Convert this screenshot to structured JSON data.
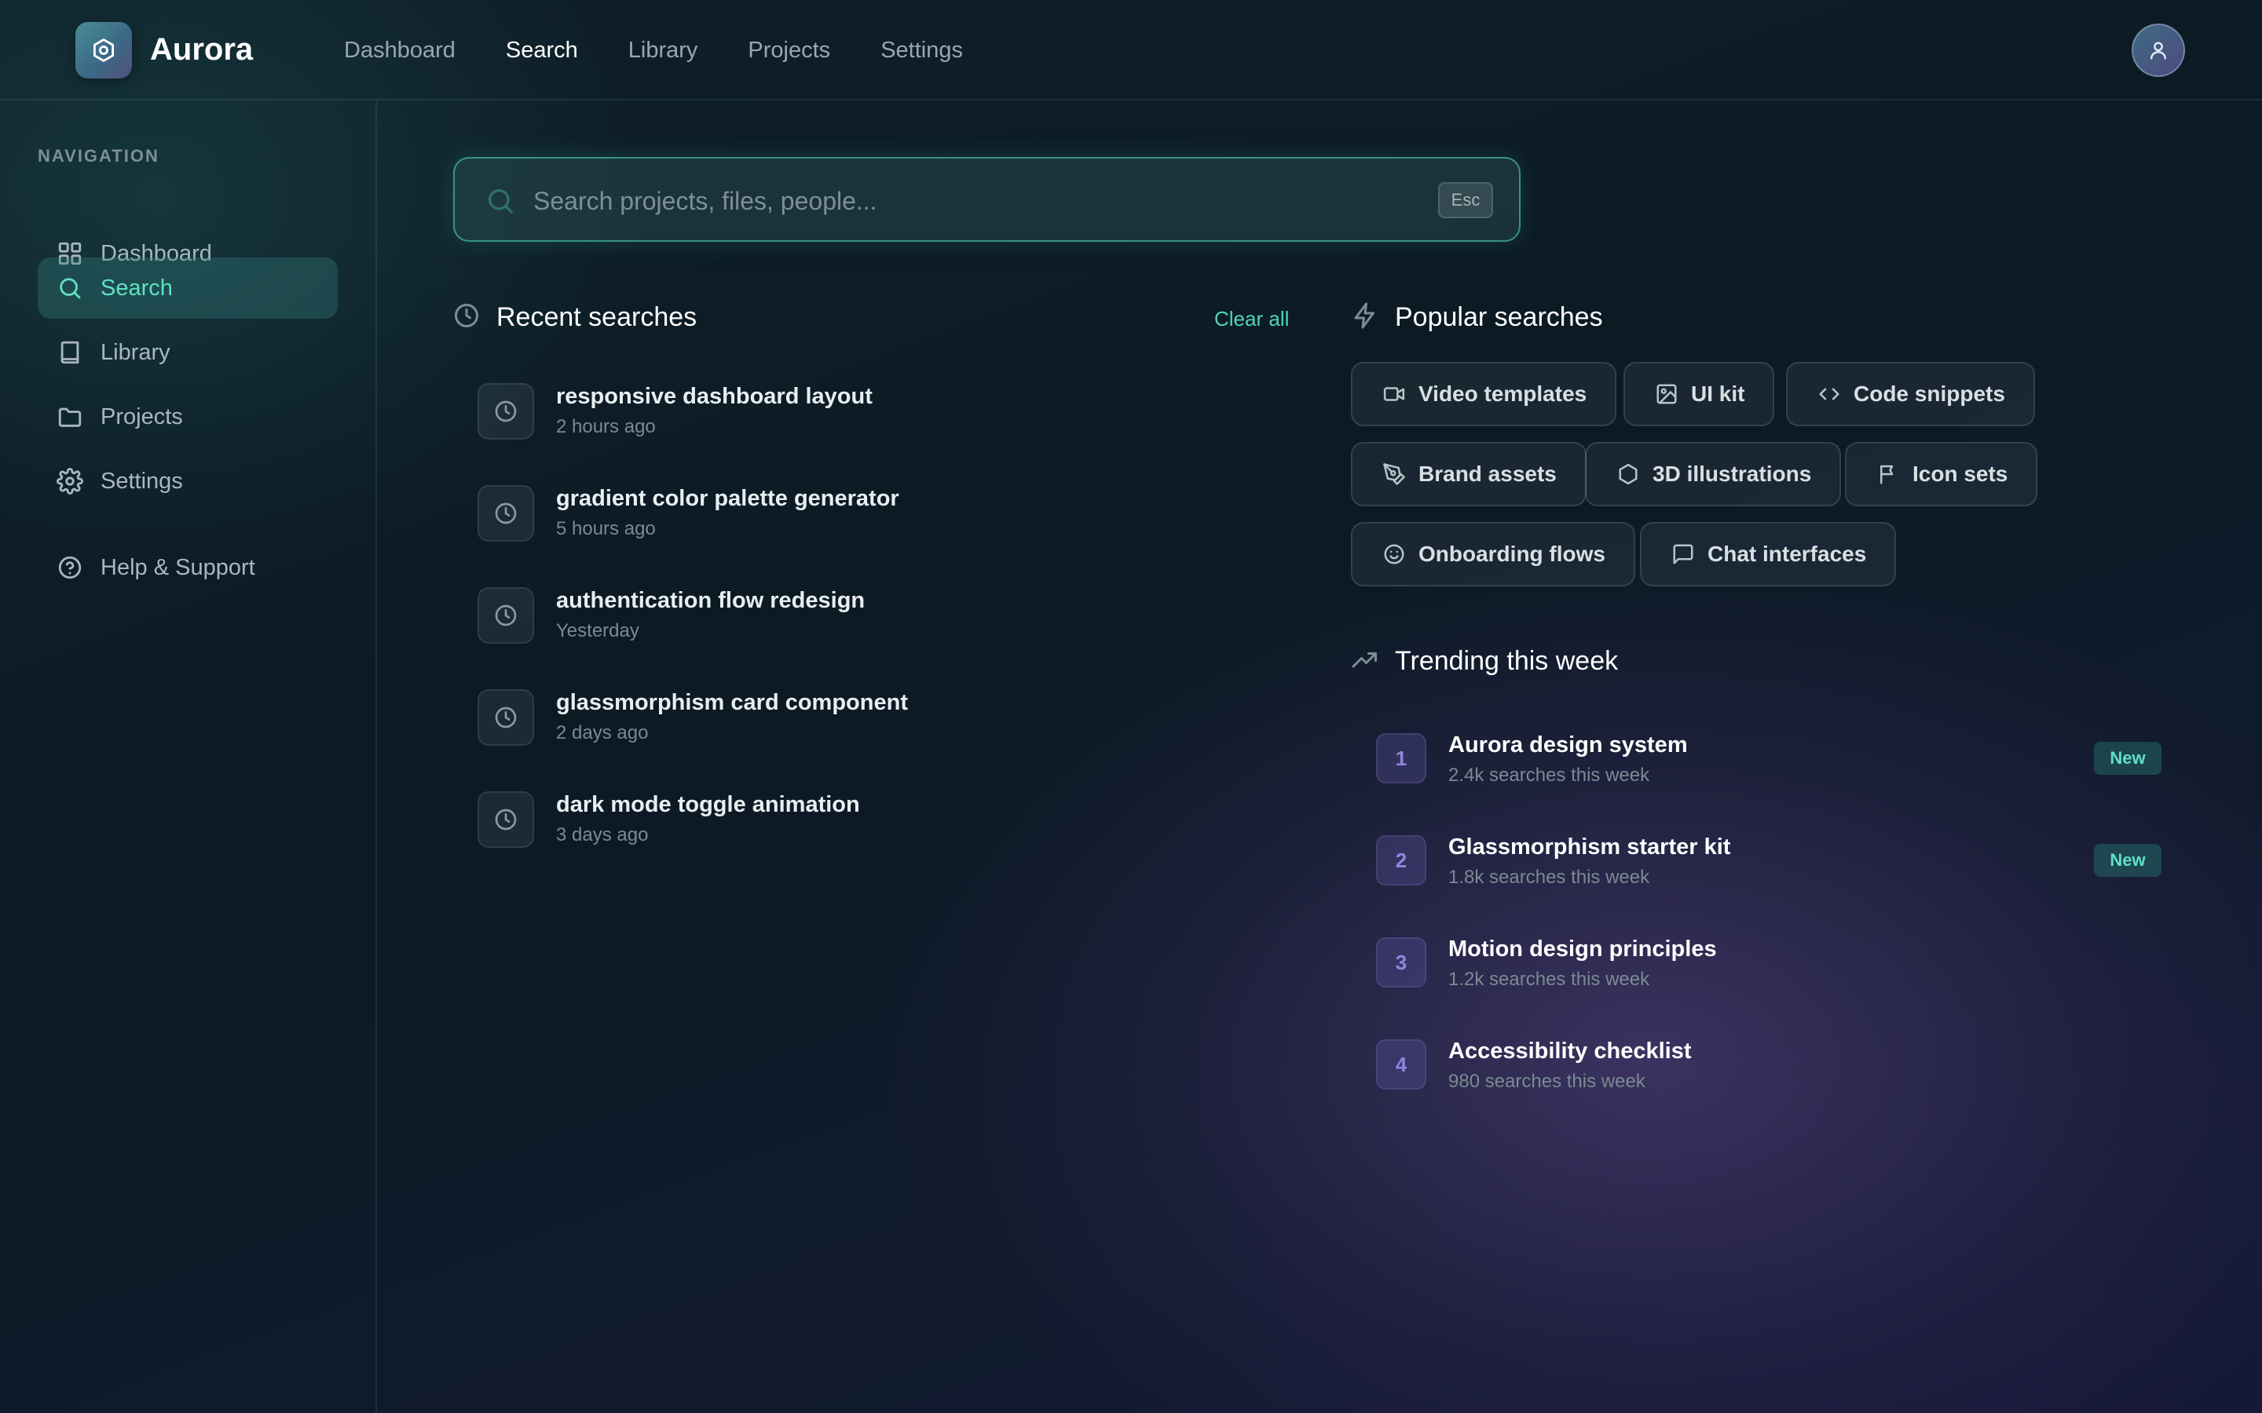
{
  "app": {
    "name": "Aurora",
    "logo_icon": "hexagon-gear-icon",
    "accent_color": "#5fe0c5"
  },
  "header": {
    "nav": [
      {
        "label": "Dashboard",
        "active": false
      },
      {
        "label": "Search",
        "active": true
      },
      {
        "label": "Library",
        "active": false
      },
      {
        "label": "Projects",
        "active": false
      },
      {
        "label": "Settings",
        "active": false
      }
    ],
    "avatar_icon": "user-icon"
  },
  "sidebar": {
    "heading": "NAVIGATION",
    "items": [
      {
        "label": "Dashboard",
        "icon": "grid-icon",
        "active": false
      },
      {
        "label": "Search",
        "icon": "search-icon",
        "active": true
      },
      {
        "label": "Library",
        "icon": "book-icon",
        "active": false
      },
      {
        "label": "Projects",
        "icon": "folder-icon",
        "active": false
      },
      {
        "label": "Settings",
        "icon": "gear-icon",
        "active": false
      }
    ],
    "help": {
      "label": "Help & Support",
      "icon": "help-circle-icon"
    }
  },
  "search": {
    "placeholder": "Search projects, files, people...",
    "value": "",
    "shortcut": "Esc"
  },
  "recent": {
    "title": "Recent searches",
    "clear_label": "Clear all",
    "items": [
      {
        "query": "responsive dashboard layout",
        "time": "2 hours ago"
      },
      {
        "query": "gradient color palette generator",
        "time": "5 hours ago"
      },
      {
        "query": "authentication flow redesign",
        "time": "Yesterday"
      },
      {
        "query": "glassmorphism card component",
        "time": "2 days ago"
      },
      {
        "query": "dark mode toggle animation",
        "time": "3 days ago"
      }
    ]
  },
  "popular": {
    "title": "Popular searches",
    "chips": [
      {
        "label": "Video templates",
        "icon": "video-icon"
      },
      {
        "label": "UI kit",
        "icon": "image-icon"
      },
      {
        "label": "Code snippets",
        "icon": "code-icon"
      },
      {
        "label": "Brand assets",
        "icon": "pen-tool-icon"
      },
      {
        "label": "3D illustrations",
        "icon": "hexagon-icon"
      },
      {
        "label": "Icon sets",
        "icon": "flag-icon"
      },
      {
        "label": "Onboarding flows",
        "icon": "smile-icon"
      },
      {
        "label": "Chat interfaces",
        "icon": "message-square-icon"
      }
    ]
  },
  "trending": {
    "title": "Trending this week",
    "items": [
      {
        "rank": "1",
        "title": "Aurora design system",
        "subtitle": "2.4k searches this week",
        "badge": "New"
      },
      {
        "rank": "2",
        "title": "Glassmorphism starter kit",
        "subtitle": "1.8k searches this week",
        "badge": "New"
      },
      {
        "rank": "3",
        "title": "Motion design principles",
        "subtitle": "1.2k searches this week",
        "badge": ""
      },
      {
        "rank": "4",
        "title": "Accessibility checklist",
        "subtitle": "980 searches this week",
        "badge": ""
      }
    ]
  }
}
